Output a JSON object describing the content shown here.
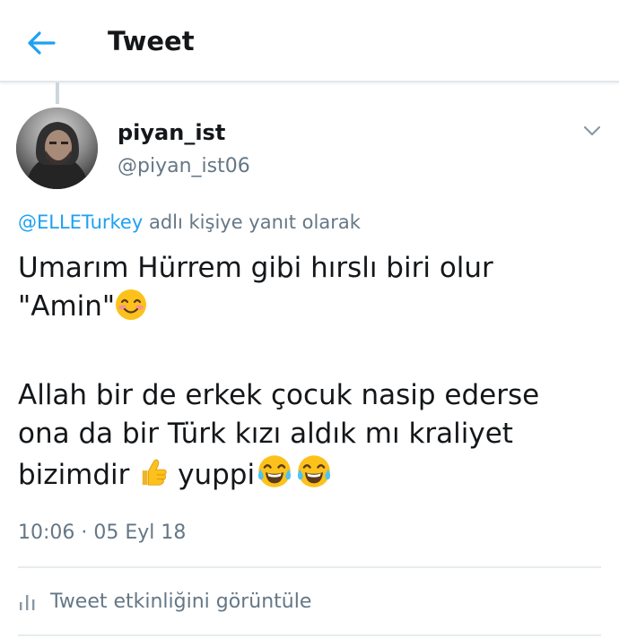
{
  "header": {
    "title": "Tweet",
    "back_icon": "arrow-left-icon"
  },
  "author": {
    "display_name": "piyan_ist",
    "handle": "@piyan_ist06"
  },
  "reply": {
    "mention": "@ELLETurkey",
    "suffix": "adlı kişiye yanıt olarak"
  },
  "tweet": {
    "line1": "Umarım Hürrem gibi hırslı biri olur",
    "line2": "\"Amin\"",
    "line3": "Allah bir de erkek çocuk nasip ederse",
    "line4": "ona da bir Türk kızı aldık mı kraliyet",
    "line5_start": "bizimdir",
    "line5_end": "yuppi",
    "emojis": [
      "smiling-face-with-blush-emoji",
      "thumbs-up-emoji",
      "tears-of-joy-emoji",
      "tears-of-joy-emoji"
    ]
  },
  "meta": {
    "timestamp": "10:06 · 05 Eyl 18"
  },
  "activity": {
    "label": "Tweet etkinliğini görüntüle",
    "icon": "bar-chart-icon"
  },
  "colors": {
    "accent": "#1da1f2",
    "secondary_text": "#657786",
    "primary_text": "#14171a",
    "divider": "#e6ecf0"
  }
}
